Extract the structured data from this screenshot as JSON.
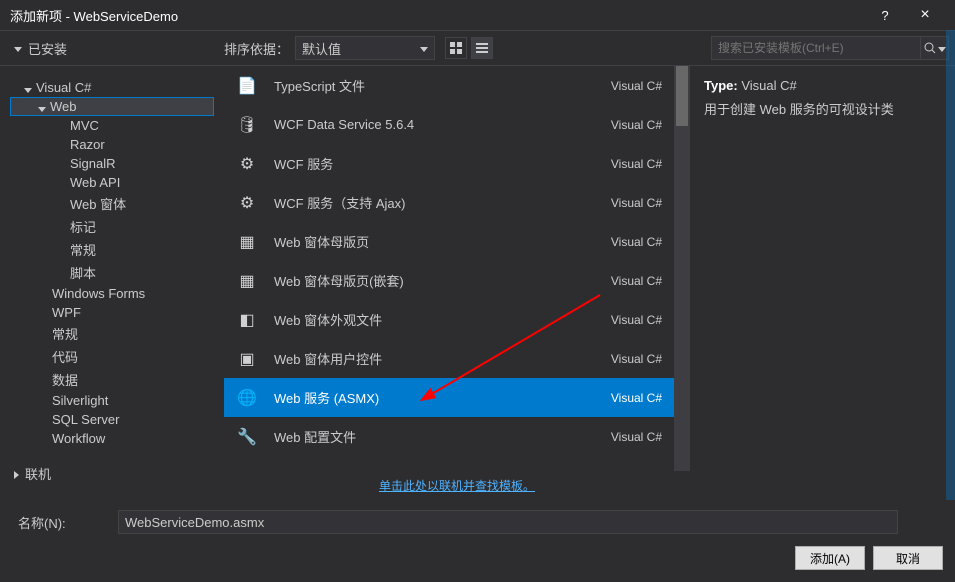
{
  "window": {
    "title": "添加新项 - WebServiceDemo",
    "help": "?",
    "close": "×"
  },
  "toolbar": {
    "installed_head": "已安装",
    "sort_label": "排序依据：",
    "sort_value": "默认值",
    "search_placeholder": "搜索已安装模板(Ctrl+E)"
  },
  "sidebar": {
    "header": "Visual C#",
    "web": "Web",
    "web_children": [
      "MVC",
      "Razor",
      "SignalR",
      "Web API",
      "Web 窗体",
      "标记",
      "常规",
      "脚本"
    ],
    "after_web": [
      "Windows Forms",
      "WPF",
      "常规",
      "代码",
      "数据",
      "Silverlight",
      "SQL Server",
      "Workflow"
    ],
    "online_head": "联机"
  },
  "templates": [
    {
      "name": "TypeScript 文件",
      "lang": "Visual C#",
      "icon": "file-icon"
    },
    {
      "name": "WCF Data Service 5.6.4",
      "lang": "Visual C#",
      "icon": "db-icon"
    },
    {
      "name": "WCF 服务",
      "lang": "Visual C#",
      "icon": "gear-icon"
    },
    {
      "name": "WCF 服务（支持 Ajax)",
      "lang": "Visual C#",
      "icon": "gear-icon"
    },
    {
      "name": "Web 窗体母版页",
      "lang": "Visual C#",
      "icon": "master-icon"
    },
    {
      "name": "Web 窗体母版页(嵌套)",
      "lang": "Visual C#",
      "icon": "master-icon"
    },
    {
      "name": "Web 窗体外观文件",
      "lang": "Visual C#",
      "icon": "skin-icon"
    },
    {
      "name": "Web 窗体用户控件",
      "lang": "Visual C#",
      "icon": "usercontrol-icon"
    },
    {
      "name": "Web 服务 (ASMX)",
      "lang": "Visual C#",
      "icon": "globe-icon",
      "selected": true
    },
    {
      "name": "Web 配置文件",
      "lang": "Visual C#",
      "icon": "wrench-icon"
    }
  ],
  "online_link": "单击此处以联机并查找模板。",
  "details": {
    "type_label": "Type:",
    "type_value": "Visual C#",
    "desc": "用于创建 Web 服务的可视设计类"
  },
  "footer": {
    "name_label": "名称(N):",
    "name_value": "WebServiceDemo.asmx",
    "add_btn": "添加(A)",
    "cancel_btn": "取消"
  }
}
